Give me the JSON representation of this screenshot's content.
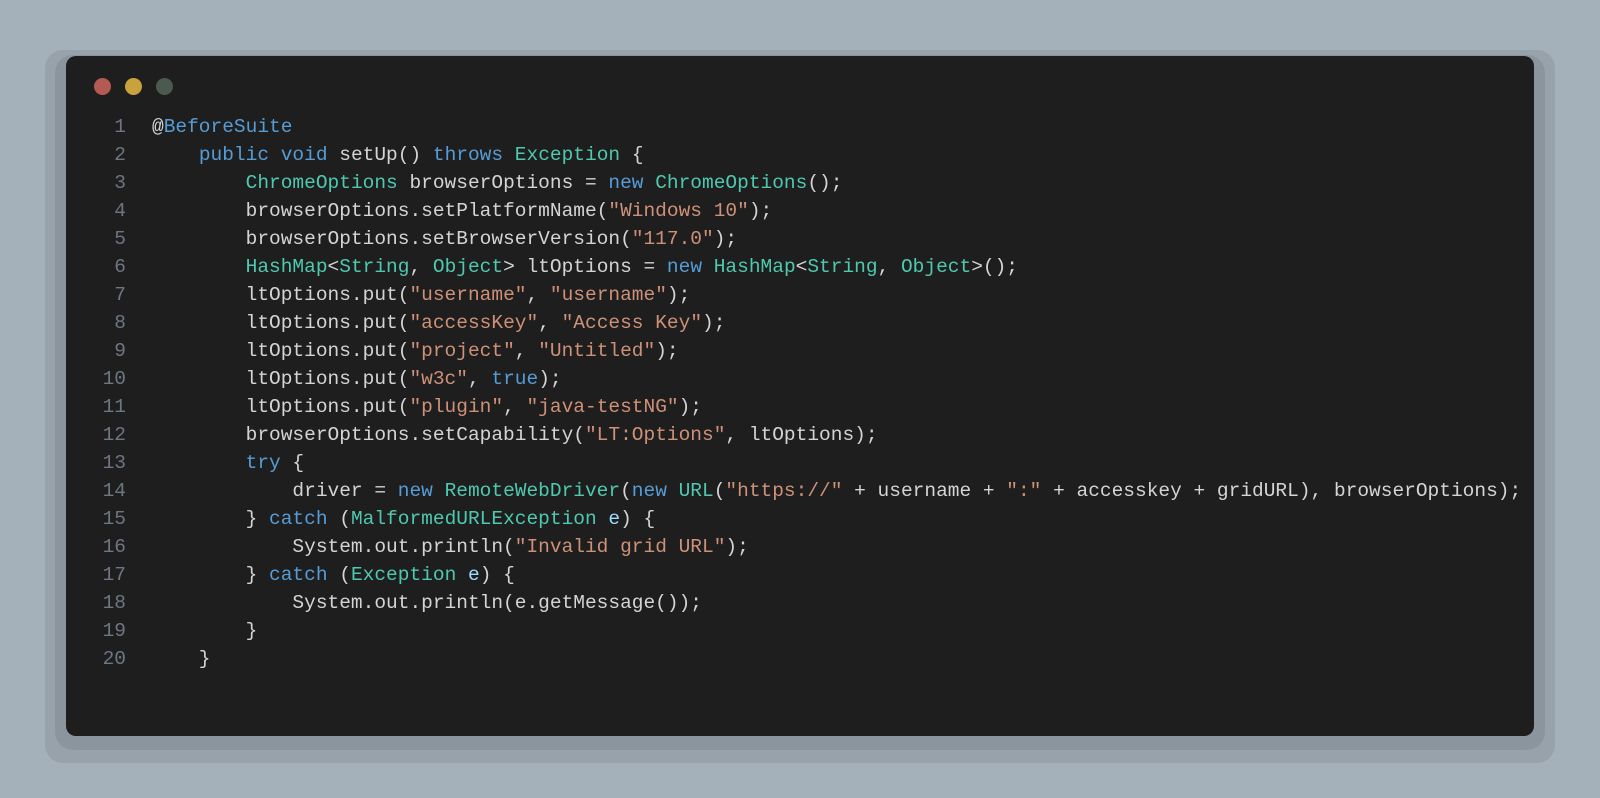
{
  "window": {
    "dot_colors": {
      "close": "#b45a52",
      "min": "#c9a23e",
      "max": "#4b5a4e"
    }
  },
  "code": {
    "lines": [
      {
        "n": "1",
        "tokens": [
          {
            "c": "t-at",
            "t": "@"
          },
          {
            "c": "t-ann",
            "t": "BeforeSuite"
          }
        ]
      },
      {
        "n": "2",
        "tokens": [
          {
            "c": "t-def",
            "t": "    "
          },
          {
            "c": "t-key",
            "t": "public"
          },
          {
            "c": "t-def",
            "t": " "
          },
          {
            "c": "t-key",
            "t": "void"
          },
          {
            "c": "t-def",
            "t": " setUp() "
          },
          {
            "c": "t-key",
            "t": "throws"
          },
          {
            "c": "t-def",
            "t": " "
          },
          {
            "c": "t-type",
            "t": "Exception"
          },
          {
            "c": "t-def",
            "t": " {"
          }
        ]
      },
      {
        "n": "3",
        "tokens": [
          {
            "c": "t-def",
            "t": "        "
          },
          {
            "c": "t-type",
            "t": "ChromeOptions"
          },
          {
            "c": "t-def",
            "t": " browserOptions = "
          },
          {
            "c": "t-key",
            "t": "new"
          },
          {
            "c": "t-def",
            "t": " "
          },
          {
            "c": "t-type",
            "t": "ChromeOptions"
          },
          {
            "c": "t-def",
            "t": "();"
          }
        ]
      },
      {
        "n": "4",
        "tokens": [
          {
            "c": "t-def",
            "t": "        browserOptions.setPlatformName("
          },
          {
            "c": "t-str",
            "t": "\"Windows 10\""
          },
          {
            "c": "t-def",
            "t": ");"
          }
        ]
      },
      {
        "n": "5",
        "tokens": [
          {
            "c": "t-def",
            "t": "        browserOptions.setBrowserVersion("
          },
          {
            "c": "t-str",
            "t": "\"117.0\""
          },
          {
            "c": "t-def",
            "t": ");"
          }
        ]
      },
      {
        "n": "6",
        "tokens": [
          {
            "c": "t-def",
            "t": "        "
          },
          {
            "c": "t-type",
            "t": "HashMap"
          },
          {
            "c": "t-def",
            "t": "<"
          },
          {
            "c": "t-type",
            "t": "String"
          },
          {
            "c": "t-def",
            "t": ", "
          },
          {
            "c": "t-type",
            "t": "Object"
          },
          {
            "c": "t-def",
            "t": "> ltOptions = "
          },
          {
            "c": "t-key",
            "t": "new"
          },
          {
            "c": "t-def",
            "t": " "
          },
          {
            "c": "t-type",
            "t": "HashMap"
          },
          {
            "c": "t-def",
            "t": "<"
          },
          {
            "c": "t-type",
            "t": "String"
          },
          {
            "c": "t-def",
            "t": ", "
          },
          {
            "c": "t-type",
            "t": "Object"
          },
          {
            "c": "t-def",
            "t": ">();"
          }
        ]
      },
      {
        "n": "7",
        "tokens": [
          {
            "c": "t-def",
            "t": "        ltOptions.put("
          },
          {
            "c": "t-str",
            "t": "\"username\""
          },
          {
            "c": "t-def",
            "t": ", "
          },
          {
            "c": "t-str",
            "t": "\"username\""
          },
          {
            "c": "t-def",
            "t": ");"
          }
        ]
      },
      {
        "n": "8",
        "tokens": [
          {
            "c": "t-def",
            "t": "        ltOptions.put("
          },
          {
            "c": "t-str",
            "t": "\"accessKey\""
          },
          {
            "c": "t-def",
            "t": ", "
          },
          {
            "c": "t-str",
            "t": "\"Access Key\""
          },
          {
            "c": "t-def",
            "t": ");"
          }
        ]
      },
      {
        "n": "9",
        "tokens": [
          {
            "c": "t-def",
            "t": "        ltOptions.put("
          },
          {
            "c": "t-str",
            "t": "\"project\""
          },
          {
            "c": "t-def",
            "t": ", "
          },
          {
            "c": "t-str",
            "t": "\"Untitled\""
          },
          {
            "c": "t-def",
            "t": ");"
          }
        ]
      },
      {
        "n": "10",
        "tokens": [
          {
            "c": "t-def",
            "t": "        ltOptions.put("
          },
          {
            "c": "t-str",
            "t": "\"w3c\""
          },
          {
            "c": "t-def",
            "t": ", "
          },
          {
            "c": "t-bool",
            "t": "true"
          },
          {
            "c": "t-def",
            "t": ");"
          }
        ]
      },
      {
        "n": "11",
        "tokens": [
          {
            "c": "t-def",
            "t": "        ltOptions.put("
          },
          {
            "c": "t-str",
            "t": "\"plugin\""
          },
          {
            "c": "t-def",
            "t": ", "
          },
          {
            "c": "t-str",
            "t": "\"java-testNG\""
          },
          {
            "c": "t-def",
            "t": ");"
          }
        ]
      },
      {
        "n": "12",
        "tokens": [
          {
            "c": "t-def",
            "t": "        browserOptions.setCapability("
          },
          {
            "c": "t-str",
            "t": "\"LT:Options\""
          },
          {
            "c": "t-def",
            "t": ", ltOptions);"
          }
        ]
      },
      {
        "n": "13",
        "tokens": [
          {
            "c": "t-def",
            "t": "        "
          },
          {
            "c": "t-key",
            "t": "try"
          },
          {
            "c": "t-def",
            "t": " {"
          }
        ]
      },
      {
        "n": "14",
        "tokens": [
          {
            "c": "t-def",
            "t": "            driver = "
          },
          {
            "c": "t-key",
            "t": "new"
          },
          {
            "c": "t-def",
            "t": " "
          },
          {
            "c": "t-type",
            "t": "RemoteWebDriver"
          },
          {
            "c": "t-def",
            "t": "("
          },
          {
            "c": "t-key",
            "t": "new"
          },
          {
            "c": "t-def",
            "t": " "
          },
          {
            "c": "t-type",
            "t": "URL"
          },
          {
            "c": "t-def",
            "t": "("
          },
          {
            "c": "t-str",
            "t": "\"https://\""
          },
          {
            "c": "t-def",
            "t": " + username + "
          },
          {
            "c": "t-str",
            "t": "\":\""
          },
          {
            "c": "t-def",
            "t": " + accesskey + gridURL), browserOptions);"
          }
        ]
      },
      {
        "n": "15",
        "tokens": [
          {
            "c": "t-def",
            "t": "        } "
          },
          {
            "c": "t-key",
            "t": "catch"
          },
          {
            "c": "t-def",
            "t": " ("
          },
          {
            "c": "t-type",
            "t": "MalformedURLException"
          },
          {
            "c": "t-def",
            "t": " "
          },
          {
            "c": "t-var",
            "t": "e"
          },
          {
            "c": "t-def",
            "t": ") {"
          }
        ]
      },
      {
        "n": "16",
        "tokens": [
          {
            "c": "t-def",
            "t": "            System.out.println("
          },
          {
            "c": "t-str",
            "t": "\"Invalid grid URL\""
          },
          {
            "c": "t-def",
            "t": ");"
          }
        ]
      },
      {
        "n": "17",
        "tokens": [
          {
            "c": "t-def",
            "t": "        } "
          },
          {
            "c": "t-key",
            "t": "catch"
          },
          {
            "c": "t-def",
            "t": " ("
          },
          {
            "c": "t-type",
            "t": "Exception"
          },
          {
            "c": "t-def",
            "t": " "
          },
          {
            "c": "t-var",
            "t": "e"
          },
          {
            "c": "t-def",
            "t": ") {"
          }
        ]
      },
      {
        "n": "18",
        "tokens": [
          {
            "c": "t-def",
            "t": "            System.out.println(e.getMessage());"
          }
        ]
      },
      {
        "n": "19",
        "tokens": [
          {
            "c": "t-def",
            "t": "        }"
          }
        ]
      },
      {
        "n": "20",
        "tokens": [
          {
            "c": "t-def",
            "t": "    }"
          }
        ]
      }
    ]
  }
}
